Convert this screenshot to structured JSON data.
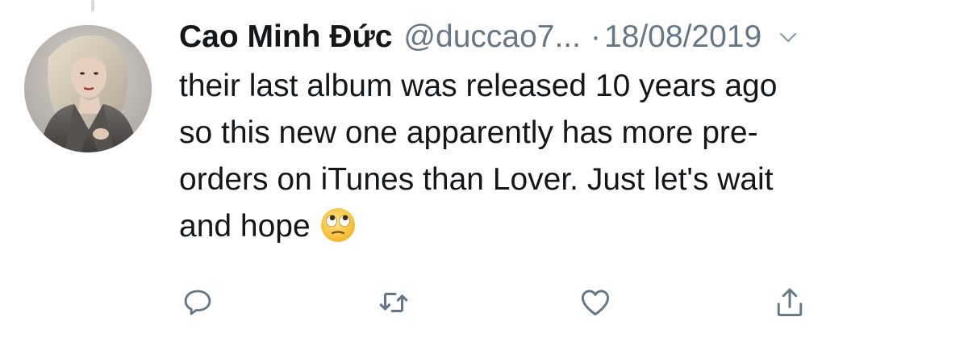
{
  "tweet": {
    "author_name": "Cao Minh Đức",
    "handle": "@duccao7...",
    "separator": "·",
    "date": "18/08/2019",
    "lines": [
      "their last album was released 10 years ago",
      "so this new one apparently has more pre-",
      "orders on iTunes than Lover. Just let's wait",
      "and hope"
    ],
    "emoji": "face-with-rolling-eyes"
  },
  "actions": {
    "reply_icon": "reply-icon",
    "retweet_icon": "retweet-icon",
    "like_icon": "heart-icon",
    "share_icon": "share-icon"
  },
  "colors": {
    "text": "#14171a",
    "secondary": "#657786",
    "icon": "#657786",
    "thread_line": "#d4d9de"
  }
}
